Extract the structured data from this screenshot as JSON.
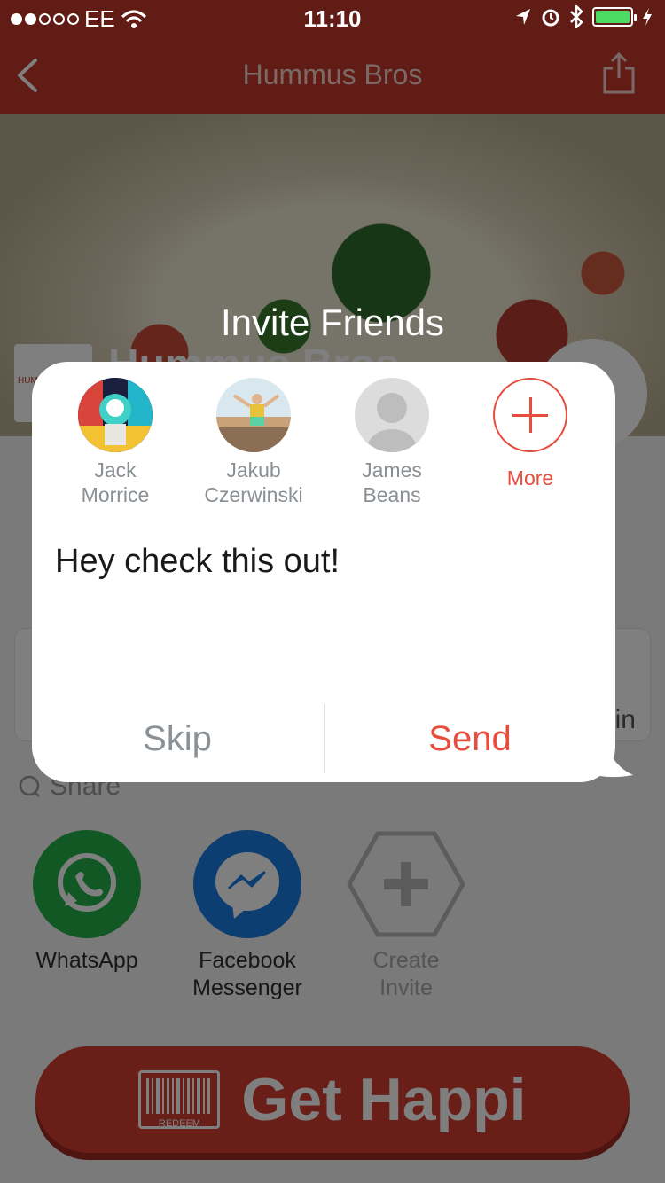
{
  "status_bar": {
    "carrier": "EE",
    "time": "11:10",
    "signal_bars_filled": 2,
    "signal_bars_total": 5,
    "battery_level": 1.0
  },
  "nav": {
    "title": "Hummus Bros",
    "back_icon": "chevron-left-icon",
    "share_icon": "share-icon"
  },
  "hero": {
    "title": "Hummus Bros",
    "logo_text": "HUMMUS"
  },
  "info_card": {
    "tail_text": "in"
  },
  "share": {
    "label": "Share",
    "apps": [
      {
        "label": "WhatsApp",
        "color": "#25b04a",
        "icon": "whatsapp-icon"
      },
      {
        "label": "Facebook Messenger",
        "color": "#1b7de3",
        "icon": "messenger-icon"
      },
      {
        "label": "Create Invite",
        "color": "#9a9a9a",
        "icon": "plus-hexagon-icon"
      }
    ]
  },
  "cta": {
    "label": "Get Happi",
    "redeem_label": "REDEEM"
  },
  "modal": {
    "title": "Invite Friends",
    "friends": [
      {
        "name_line1": "Jack",
        "name_line2": "Morrice"
      },
      {
        "name_line1": "Jakub",
        "name_line2": "Czerwinski"
      },
      {
        "name_line1": "James",
        "name_line2": "Beans"
      }
    ],
    "more_label": "More",
    "message": "Hey check this out!",
    "skip_label": "Skip",
    "send_label": "Send"
  },
  "colors": {
    "brand_red": "#e74c3c",
    "nav_red": "#c0392b",
    "muted_gray": "#8c9196"
  }
}
